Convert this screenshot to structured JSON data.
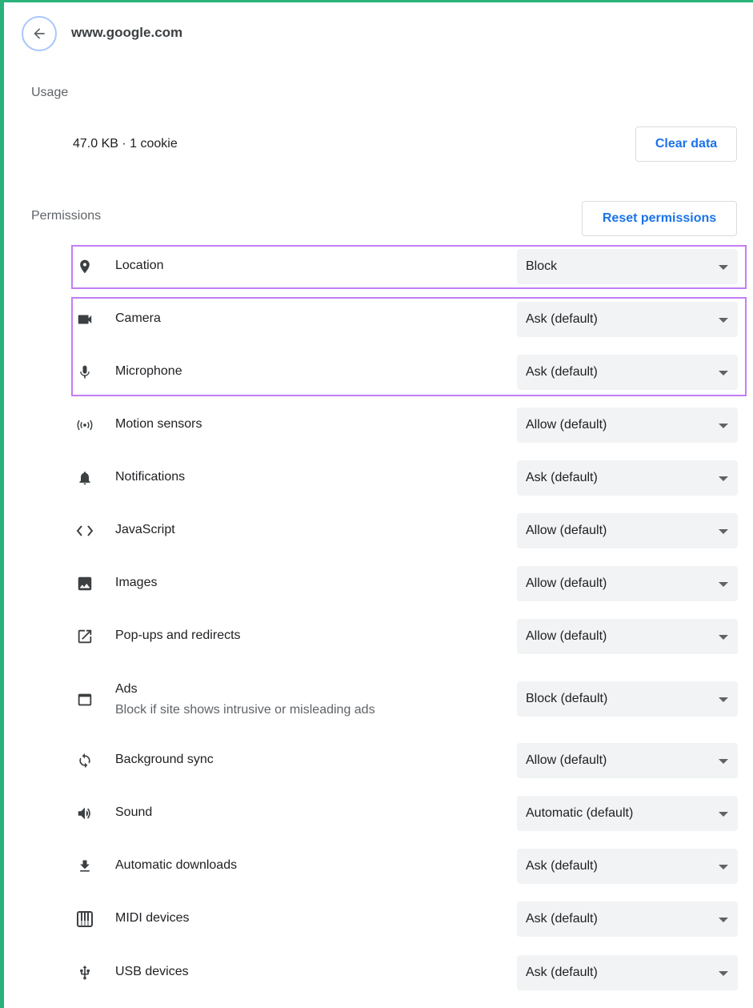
{
  "header": {
    "site": "www.google.com"
  },
  "usage": {
    "title": "Usage",
    "summary": "47.0 KB · 1 cookie",
    "clear_label": "Clear data"
  },
  "permissions": {
    "title": "Permissions",
    "reset_label": "Reset permissions",
    "items": [
      {
        "label": "Location",
        "value": "Block",
        "icon": "location-pin-icon"
      },
      {
        "label": "Camera",
        "value": "Ask (default)",
        "icon": "camera-icon"
      },
      {
        "label": "Microphone",
        "value": "Ask (default)",
        "icon": "microphone-icon"
      },
      {
        "label": "Motion sensors",
        "value": "Allow (default)",
        "icon": "motion-sensors-icon"
      },
      {
        "label": "Notifications",
        "value": "Ask (default)",
        "icon": "bell-icon"
      },
      {
        "label": "JavaScript",
        "value": "Allow (default)",
        "icon": "code-icon"
      },
      {
        "label": "Images",
        "value": "Allow (default)",
        "icon": "image-icon"
      },
      {
        "label": "Pop-ups and redirects",
        "value": "Allow (default)",
        "icon": "open-in-new-icon"
      },
      {
        "label": "Ads",
        "sublabel": "Block if site shows intrusive or misleading ads",
        "value": "Block (default)",
        "icon": "web-window-icon"
      },
      {
        "label": "Background sync",
        "value": "Allow (default)",
        "icon": "sync-icon"
      },
      {
        "label": "Sound",
        "value": "Automatic (default)",
        "icon": "speaker-icon"
      },
      {
        "label": "Automatic downloads",
        "value": "Ask (default)",
        "icon": "download-icon"
      },
      {
        "label": "MIDI devices",
        "value": "Ask (default)",
        "icon": "piano-keys-icon"
      },
      {
        "label": "USB devices",
        "value": "Ask (default)",
        "icon": "usb-icon"
      }
    ]
  },
  "colors": {
    "accent": "#1a73e8",
    "highlight": "#c27ef5",
    "frame": "#2ab27b"
  }
}
